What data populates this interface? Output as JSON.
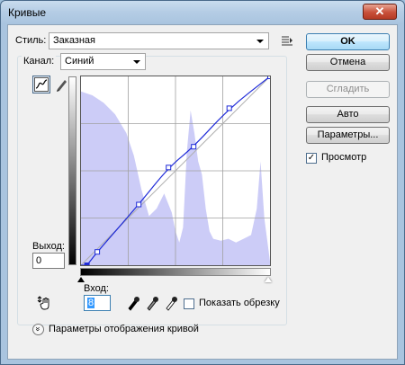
{
  "window": {
    "title": "Кривые",
    "close_glyph": "✕"
  },
  "style": {
    "label": "Стиль:",
    "value": "Заказная",
    "menu_icon": "list-options-icon"
  },
  "channel": {
    "label": "Канал:",
    "value": "Синий"
  },
  "output": {
    "label": "Выход:",
    "value": "0"
  },
  "input": {
    "label": "Вход:",
    "value": "8"
  },
  "buttons": {
    "ok": "OK",
    "cancel": "Отмена",
    "smooth": "Сгладить",
    "auto": "Авто",
    "params": "Параметры..."
  },
  "preview": {
    "label": "Просмотр",
    "checked": true,
    "check_glyph": "✓"
  },
  "show_clipping": {
    "label": "Показать обрезку",
    "checked": false
  },
  "curve_display": {
    "label": "Параметры отображения кривой",
    "expand_glyph": "»"
  },
  "colors": {
    "histogram": "#ccccf7",
    "curve": "#1f2bd8",
    "accent": "#3c7fb1"
  },
  "curve": {
    "channel": "blue",
    "points": [
      [
        8,
        0
      ],
      [
        22,
        18
      ],
      [
        78,
        82
      ],
      [
        118,
        132
      ],
      [
        152,
        160
      ],
      [
        200,
        212
      ],
      [
        255,
        255
      ]
    ]
  }
}
